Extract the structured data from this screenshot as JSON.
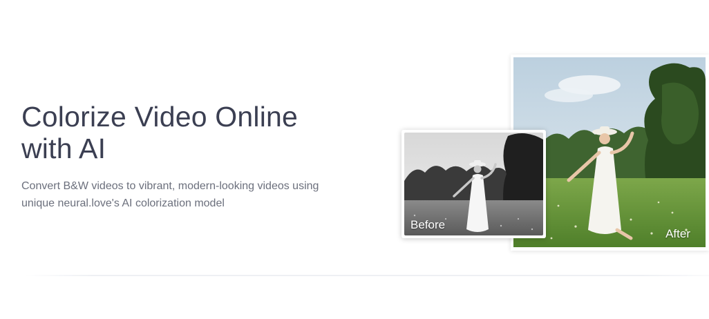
{
  "hero": {
    "title_line1": "Colorize Video Online",
    "title_line2": "with AI",
    "description_line1": "Convert B&W videos to vibrant, modern-looking videos using",
    "description_line2": "unique neural.love's AI colorization model"
  },
  "comparison": {
    "before_label": "Before",
    "after_label": "After"
  },
  "colors": {
    "headline": "#3b3f52",
    "body_text": "#6b6f7c",
    "sky": "#cfdde8",
    "grass": "#6d9a3f",
    "trees": "#2f4a22"
  }
}
